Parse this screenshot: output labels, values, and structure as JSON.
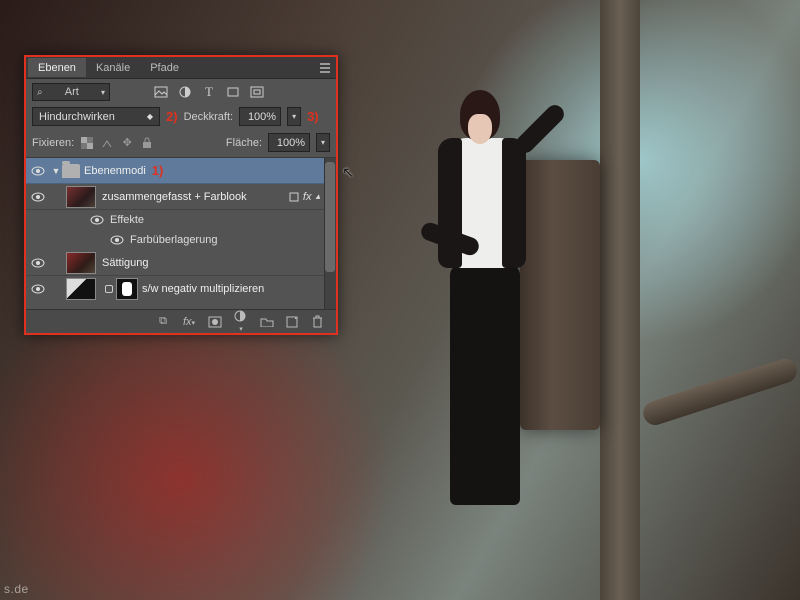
{
  "tabs": {
    "layers": "Ebenen",
    "channels": "Kanäle",
    "paths": "Pfade"
  },
  "filter": {
    "label": "Art"
  },
  "blend": {
    "mode": "Hindurchwirken",
    "opacity_label": "Deckkraft:",
    "opacity_value": "100%"
  },
  "lock": {
    "label": "Fixieren:",
    "fill_label": "Fläche:",
    "fill_value": "100%"
  },
  "annotations": {
    "a1": "1)",
    "a2": "2)",
    "a3": "3)"
  },
  "layers": {
    "group": "Ebenenmodi",
    "l1": "zusammengefasst + Farblook",
    "fx_label": "fx",
    "effects": "Effekte",
    "coloroverlay": "Farbüberlagerung",
    "l2": "Sättigung",
    "l3": "s/w negativ multiplizieren"
  },
  "watermark": "s.de"
}
